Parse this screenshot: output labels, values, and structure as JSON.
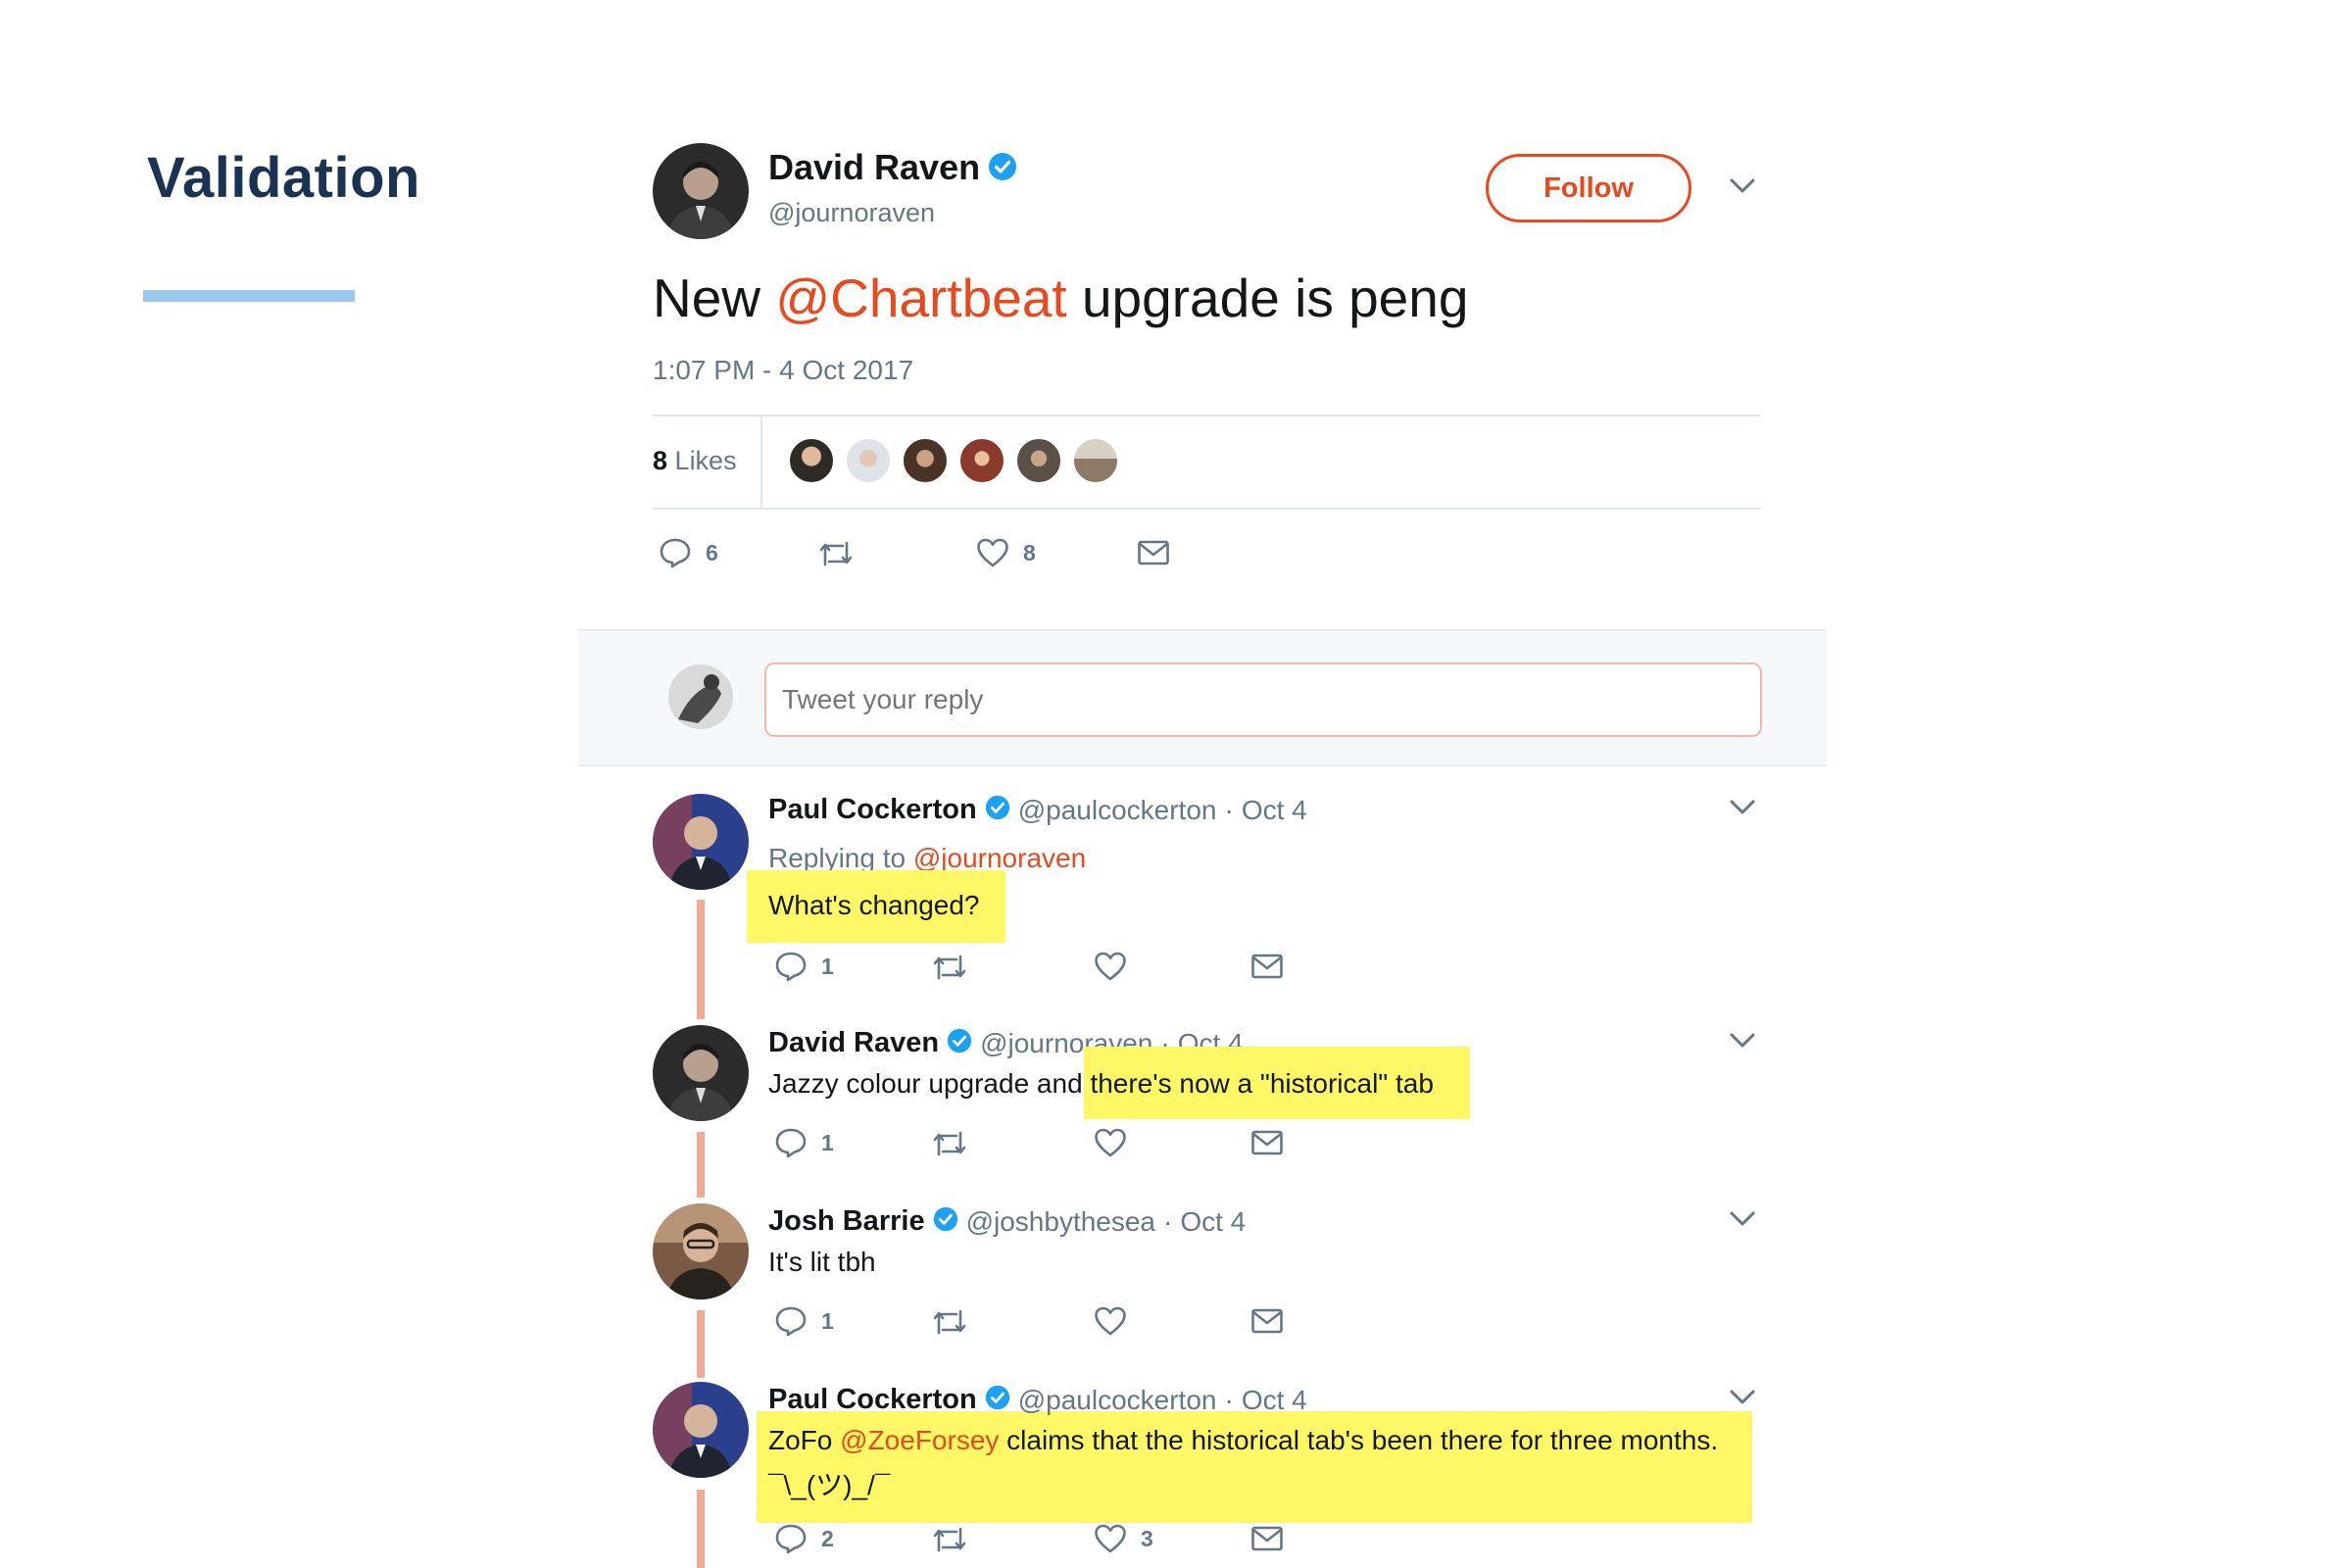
{
  "section": {
    "title": "Validation"
  },
  "tweet": {
    "author_name": "David Raven",
    "author_handle": "@journoraven",
    "follow_label": "Follow",
    "text_prefix": "New ",
    "mention": "@Chartbeat",
    "text_suffix": " upgrade is peng",
    "timestamp": "1:07 PM - 4 Oct 2017",
    "likes_count": "8",
    "likes_label": "Likes",
    "reply_count": "6",
    "like_count": "8"
  },
  "composer": {
    "placeholder": "Tweet your reply"
  },
  "replies": [
    {
      "name": "Paul Cockerton",
      "handle": "@paulcockerton",
      "date": "Oct 4",
      "replying_prefix": "Replying to ",
      "replying_to": "@journoraven",
      "text": "What's changed?",
      "reply_count": "1",
      "like_count": ""
    },
    {
      "name": "David Raven",
      "handle": "@journoraven",
      "date": "Oct 4",
      "text_plain": "Jazzy colour upgrade and ",
      "text_highlight": "there's now a \"historical\" tab",
      "reply_count": "1",
      "like_count": ""
    },
    {
      "name": "Josh Barrie",
      "handle": "@joshbythesea",
      "date": "Oct 4",
      "text": "It's lit tbh",
      "reply_count": "1",
      "like_count": ""
    },
    {
      "name": "Paul Cockerton",
      "handle": "@paulcockerton",
      "date": "Oct 4",
      "text_prefix": "ZoFo ",
      "mention": "@ZoeForsey",
      "text_suffix": " claims that the historical tab's been there for three months.",
      "text_line2": "¯\\_(ツ)_/¯",
      "reply_count": "2",
      "like_count": "3"
    }
  ],
  "colors": {
    "accent": "#e8491d",
    "verified": "#1da1f2",
    "highlight": "#fff866",
    "thread_line": "#f3a992",
    "title": "#1a3352",
    "underline": "#9cc8ea"
  }
}
